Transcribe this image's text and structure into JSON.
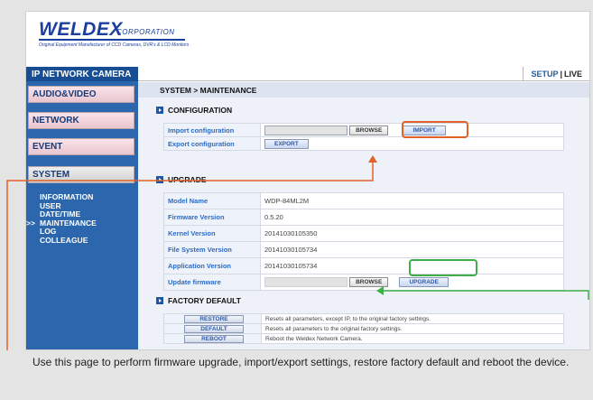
{
  "brand": {
    "name": "WELDEX",
    "corporation": "CORPORATION",
    "tagline": "Original Equipment Manufacturer of CCD Cameras, DVR's & LCD Monitors"
  },
  "sidebar": {
    "header": "IP NETWORK CAMERA",
    "items": [
      {
        "label": "AUDIO&VIDEO"
      },
      {
        "label": "NETWORK"
      },
      {
        "label": "EVENT"
      },
      {
        "label": "SYSTEM"
      }
    ],
    "submenu": [
      {
        "label": "INFORMATION",
        "marker": ""
      },
      {
        "label": "USER",
        "marker": ""
      },
      {
        "label": "DATE/TIME",
        "marker": ""
      },
      {
        "label": "MAINTENANCE",
        "marker": ">>"
      },
      {
        "label": "LOG",
        "marker": ""
      },
      {
        "label": "COLLEAGUE",
        "marker": ""
      }
    ]
  },
  "topbar": {
    "setup": "SETUP",
    "separator": "|",
    "live": "LIVE"
  },
  "breadcrumb": "SYSTEM > MAINTENANCE",
  "configuration": {
    "title": "CONFIGURATION",
    "import_label": "Import configuration",
    "import_value": "",
    "browse_label": "BROWSE",
    "import_button": "IMPORT",
    "export_label": "Export configuration",
    "export_button": "EXPORT"
  },
  "upgrade": {
    "title": "UPGRADE",
    "rows": [
      {
        "label": "Model Name",
        "value": "WDP-84ML2M"
      },
      {
        "label": "Firmware Version",
        "value": "0.5.20"
      },
      {
        "label": "Kernel Version",
        "value": "20141030105350"
      },
      {
        "label": "File System Version",
        "value": "20141030105734"
      },
      {
        "label": "Application Version",
        "value": "20141030105734"
      }
    ],
    "update_label": "Update firmware",
    "browse_label": "BROWSE",
    "upgrade_button": "UPGRADE"
  },
  "factory_default": {
    "title": "FACTORY DEFAULT",
    "rows": [
      {
        "button": "RESTORE",
        "description": "Resets all parameters, except IP, to the original factory settings."
      },
      {
        "button": "DEFAULT",
        "description": "Resets all parameters to the original factory settings."
      },
      {
        "button": "REBOOT",
        "description": "Reboot the Weldex Network Camera."
      }
    ]
  },
  "caption": "Use this page to perform firmware upgrade, import/export settings, restore factory default and reboot the device.",
  "colors": {
    "highlight_orange": "#e0622a",
    "highlight_green": "#3fae49",
    "brand_blue": "#1b3f9c",
    "sidebar_blue": "#2c66ad"
  }
}
